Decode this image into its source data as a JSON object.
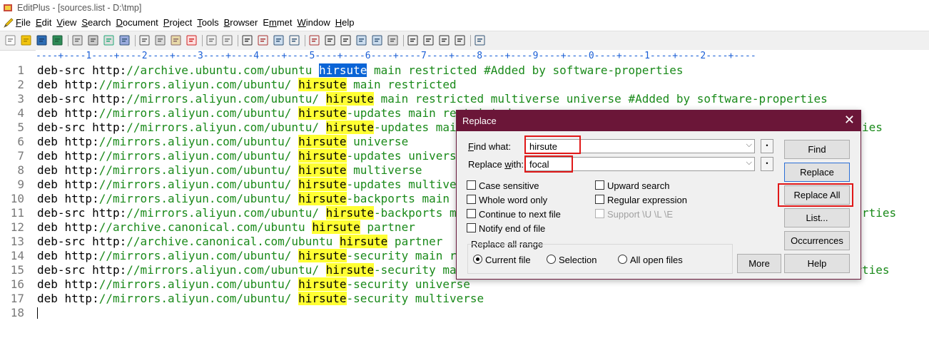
{
  "window": {
    "title": "EditPlus - [sources.list - D:\\tmp]",
    "app_icon": "editplus-app-icon"
  },
  "menu": [
    {
      "label": "File",
      "key": "F",
      "rest": "ile"
    },
    {
      "label": "Edit",
      "key": "E",
      "rest": "dit"
    },
    {
      "label": "View",
      "key": "V",
      "rest": "iew"
    },
    {
      "label": "Search",
      "key": "S",
      "rest": "earch"
    },
    {
      "label": "Document",
      "key": "D",
      "rest": "ocument"
    },
    {
      "label": "Project",
      "key": "P",
      "rest": "roject"
    },
    {
      "label": "Tools",
      "key": "T",
      "rest": "ools"
    },
    {
      "label": "Browser",
      "key": "B",
      "rest": "rowser"
    },
    {
      "label": "Emmet",
      "key": "E",
      "pre": "E",
      "rest": "mmet",
      "underline_index": 1
    },
    {
      "label": "Window",
      "key": "W",
      "rest": "indow"
    },
    {
      "label": "Help",
      "key": "H",
      "rest": "elp"
    }
  ],
  "ruler": "----+----1----+----2----+----3----+----4----+----5----+----6----+----7----+----8----+----9----+----0----+----1----+----2----+----",
  "editor": {
    "lines": [
      {
        "n": "1",
        "prefix": "deb-src http:",
        "url": "//archive.ubuntu.com/ubuntu ",
        "hit": "hirsute",
        "hit_style": "sel",
        "after": " main restricted #Added by software-properties"
      },
      {
        "n": "2",
        "prefix": "deb http:",
        "url": "//mirrors.aliyun.com/ubuntu/ ",
        "hit": "hirsute",
        "hit_style": "hl",
        "after": " main restricted"
      },
      {
        "n": "3",
        "prefix": "deb-src http:",
        "url": "//mirrors.aliyun.com/ubuntu/ ",
        "hit": "hirsute",
        "hit_style": "hl",
        "after": " main restricted multiverse universe #Added by software-properties"
      },
      {
        "n": "4",
        "prefix": "deb http:",
        "url": "//mirrors.aliyun.com/ubuntu/ ",
        "hit": "hirsute",
        "hit_style": "hl",
        "after": "-updates main restricted"
      },
      {
        "n": "5",
        "prefix": "deb-src http:",
        "url": "//mirrors.aliyun.com/ubuntu/ ",
        "hit": "hirsute",
        "hit_style": "hl",
        "after": "-updates main restricted multiverse universe #Added by software-properties"
      },
      {
        "n": "6",
        "prefix": "deb http:",
        "url": "//mirrors.aliyun.com/ubuntu/ ",
        "hit": "hirsute",
        "hit_style": "hl",
        "after": " universe"
      },
      {
        "n": "7",
        "prefix": "deb http:",
        "url": "//mirrors.aliyun.com/ubuntu/ ",
        "hit": "hirsute",
        "hit_style": "hl",
        "after": "-updates universe"
      },
      {
        "n": "8",
        "prefix": "deb http:",
        "url": "//mirrors.aliyun.com/ubuntu/ ",
        "hit": "hirsute",
        "hit_style": "hl",
        "after": " multiverse"
      },
      {
        "n": "9",
        "prefix": "deb http:",
        "url": "//mirrors.aliyun.com/ubuntu/ ",
        "hit": "hirsute",
        "hit_style": "hl",
        "after": "-updates multiverse"
      },
      {
        "n": "10",
        "prefix": "deb http:",
        "url": "//mirrors.aliyun.com/ubuntu/ ",
        "hit": "hirsute",
        "hit_style": "hl",
        "after": "-backports main restricted universe multiverse"
      },
      {
        "n": "11",
        "prefix": "deb-src http:",
        "url": "//mirrors.aliyun.com/ubuntu/ ",
        "hit": "hirsute",
        "hit_style": "hl",
        "after": "-backports main restricted universe multiverse #Added by software-properties"
      },
      {
        "n": "12",
        "prefix": "deb http:",
        "url": "//archive.canonical.com/ubuntu ",
        "hit": "hirsute",
        "hit_style": "hl",
        "after": " partner"
      },
      {
        "n": "13",
        "prefix": "deb-src http:",
        "url": "//archive.canonical.com/ubuntu ",
        "hit": "hirsute",
        "hit_style": "hl",
        "after": " partner"
      },
      {
        "n": "14",
        "prefix": "deb http:",
        "url": "//mirrors.aliyun.com/ubuntu/ ",
        "hit": "hirsute",
        "hit_style": "hl",
        "after": "-security main restricted"
      },
      {
        "n": "15",
        "prefix": "deb-src http:",
        "url": "//mirrors.aliyun.com/ubuntu/ ",
        "hit": "hirsute",
        "hit_style": "hl",
        "after": "-security main restricted multiverse universe #Added by software-properties"
      },
      {
        "n": "16",
        "prefix": "deb http:",
        "url": "//mirrors.aliyun.com/ubuntu/ ",
        "hit": "hirsute",
        "hit_style": "hl",
        "after": "-security universe"
      },
      {
        "n": "17",
        "prefix": "deb http:",
        "url": "//mirrors.aliyun.com/ubuntu/ ",
        "hit": "hirsute",
        "hit_style": "hl",
        "after": "-security multiverse"
      },
      {
        "n": "18",
        "prefix": "",
        "url": "",
        "hit": "",
        "hit_style": "",
        "after": ""
      }
    ]
  },
  "dialog": {
    "title": "Replace",
    "find_label": "Find what:",
    "find_value": "hirsute",
    "replace_label": "Replace with:",
    "replace_value": "focal",
    "options": {
      "case_sensitive": "Case sensitive",
      "whole_word": "Whole word only",
      "continue_next": "Continue to next file",
      "notify_end": "Notify end of file",
      "upward": "Upward search",
      "regex": "Regular expression",
      "support": "Support \\U \\L \\E"
    },
    "range_label": "Replace all range",
    "range": {
      "current": "Current file",
      "selection": "Selection",
      "all_open": "All open files",
      "selected": "current"
    },
    "buttons": {
      "find": "Find",
      "replace": "Replace",
      "replace_all": "Replace All",
      "list": "List...",
      "occurrences": "Occurrences",
      "more": "More",
      "help": "Help"
    }
  },
  "colors": {
    "highlight": "#ffff33",
    "selection": "#0a64d6",
    "url": "#1a8a1a",
    "dialog_title": "#6b1638",
    "annotation": "#e01818"
  }
}
